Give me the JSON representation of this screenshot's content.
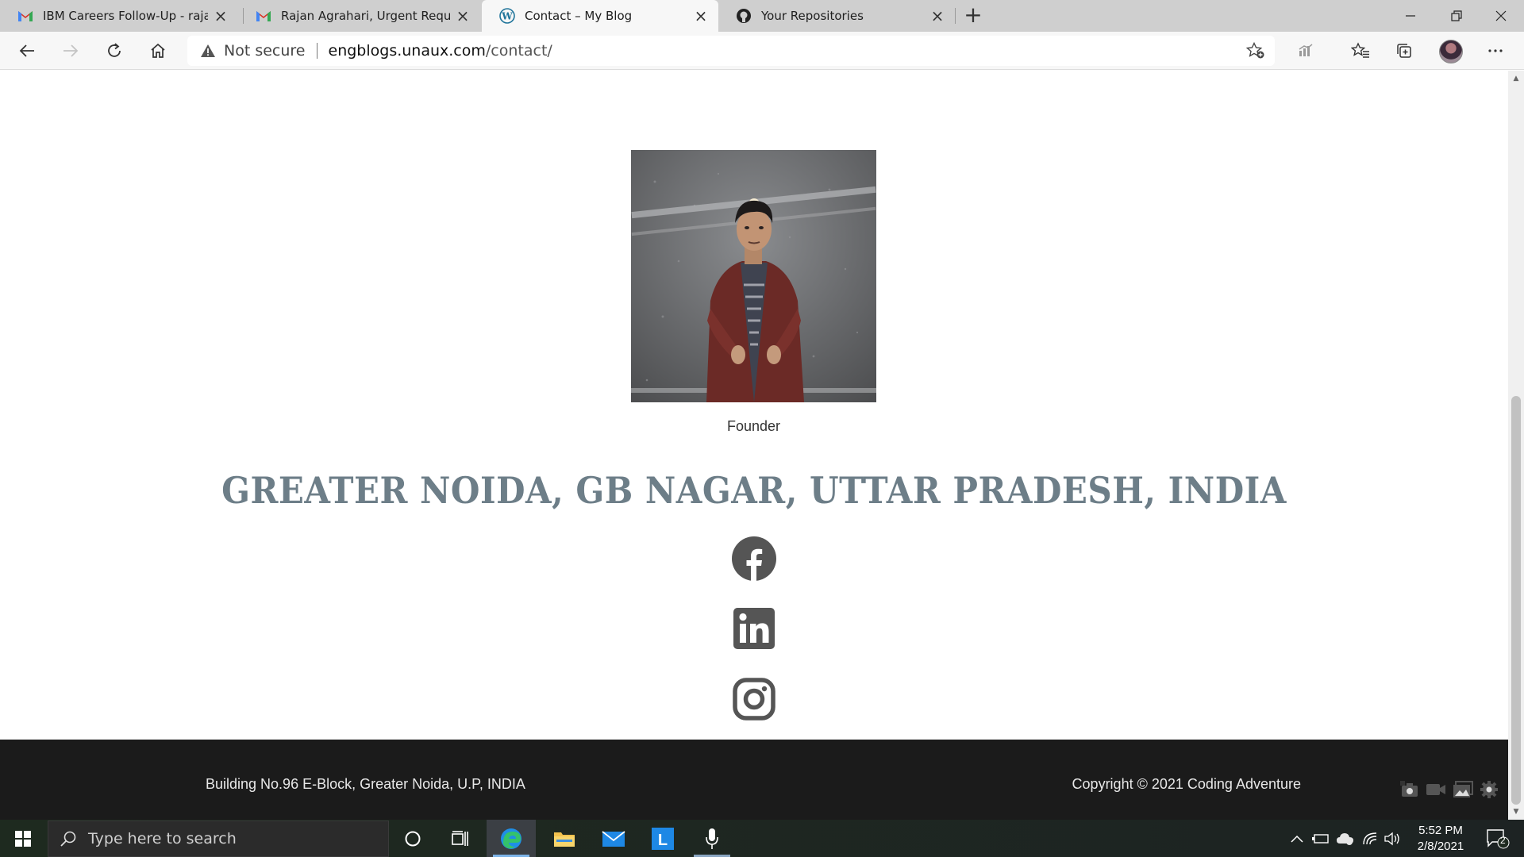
{
  "browser": {
    "tabs": [
      {
        "title": "IBM Careers Follow-Up - rajanag",
        "favicon": "gmail-icon",
        "active": false
      },
      {
        "title": "Rajan Agrahari, Urgent Requirem",
        "favicon": "gmail-icon",
        "active": false
      },
      {
        "title": "Contact – My Blog",
        "favicon": "wordpress-icon",
        "active": true
      },
      {
        "title": "Your Repositories",
        "favicon": "github-icon",
        "active": false
      }
    ],
    "address": {
      "security_label": "Not secure",
      "host": "engblogs.unaux.com",
      "path": "/contact/"
    }
  },
  "page": {
    "caption": "Founder",
    "location_heading": "GREATER NOIDA, GB NAGAR, UTTAR PRADESH, INDIA",
    "social_icons": [
      "facebook-icon",
      "linkedin-icon",
      "instagram-icon"
    ],
    "footer": {
      "address": "Building No.96 E-Block, Greater Noida, U.P, INDIA",
      "copyright": "Copyright © 2021 Coding Adventure"
    }
  },
  "taskbar": {
    "search_placeholder": "Type here to search",
    "time": "5:52 PM",
    "date": "2/8/2021",
    "notification_count": "2"
  },
  "colors": {
    "heading": "#6d7e88",
    "icon": "#555555",
    "footer_bg": "#1b1b1b"
  }
}
